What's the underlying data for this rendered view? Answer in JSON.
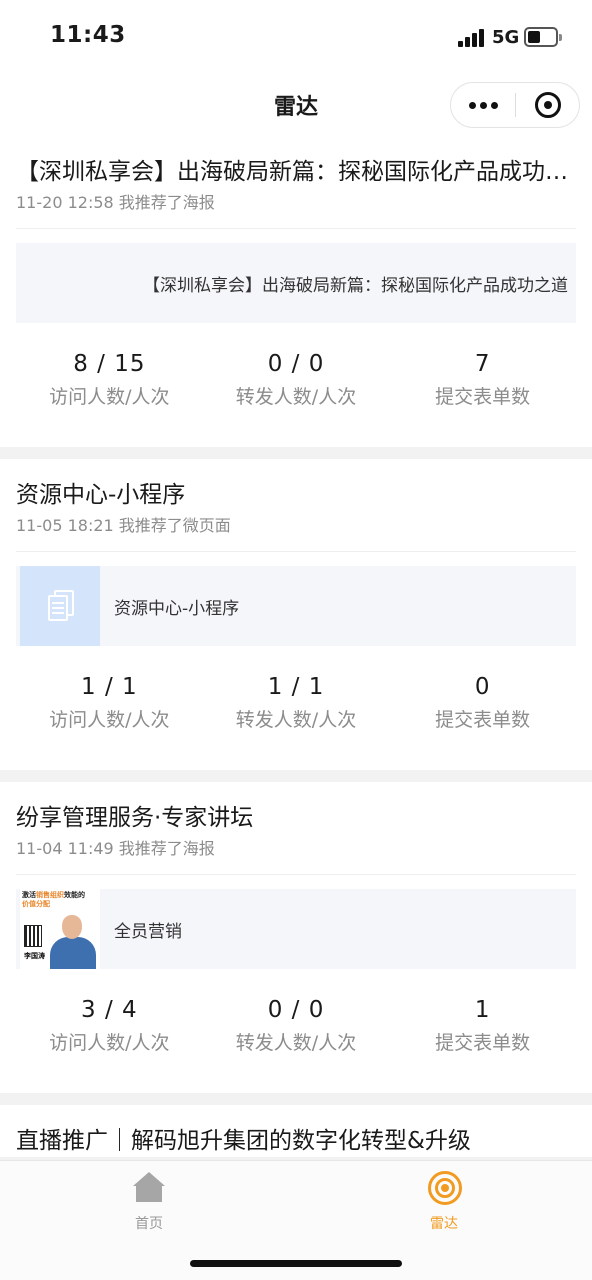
{
  "status_bar": {
    "time": "11:43",
    "network": "5G"
  },
  "nav": {
    "title": "雷达"
  },
  "cards": [
    {
      "title": "【深圳私享会】出海破局新篇：探秘国际化产品成功之道",
      "meta": "11-20 12:58 我推荐了海报",
      "preview_text": "【深圳私享会】出海破局新篇：探秘国际化产品成功之道",
      "stats": [
        {
          "value": "8 / 15",
          "label": "访问人数/人次"
        },
        {
          "value": "0 / 0",
          "label": "转发人数/人次"
        },
        {
          "value": "7",
          "label": "提交表单数"
        }
      ]
    },
    {
      "title": "资源中心-小程序",
      "meta": "11-05 18:21 我推荐了微页面",
      "preview_text": "资源中心-小程序",
      "preview_icon": "document-icon",
      "stats": [
        {
          "value": "1 / 1",
          "label": "访问人数/人次"
        },
        {
          "value": "1 / 1",
          "label": "转发人数/人次"
        },
        {
          "value": "0",
          "label": "提交表单数"
        }
      ]
    },
    {
      "title": "纷享管理服务·专家讲坛",
      "meta": "11-04 11:49 我推荐了海报",
      "preview_text": "全员营销",
      "poster": {
        "headline_prefix": "激活",
        "headline_highlight": "销售组织",
        "headline_suffix": "效能的",
        "subline": "价值分配",
        "name": "李国涛"
      },
      "stats": [
        {
          "value": "3 / 4",
          "label": "访问人数/人次"
        },
        {
          "value": "0 / 0",
          "label": "转发人数/人次"
        },
        {
          "value": "1",
          "label": "提交表单数"
        }
      ]
    },
    {
      "title": "直播推广｜解码旭升集团的数字化转型&升级"
    }
  ],
  "tab_bar": {
    "items": [
      {
        "label": "首页",
        "icon": "home-icon",
        "active": false
      },
      {
        "label": "雷达",
        "icon": "radar-icon",
        "active": true
      }
    ],
    "active_color": "#f29b22",
    "inactive_color": "#999999"
  }
}
